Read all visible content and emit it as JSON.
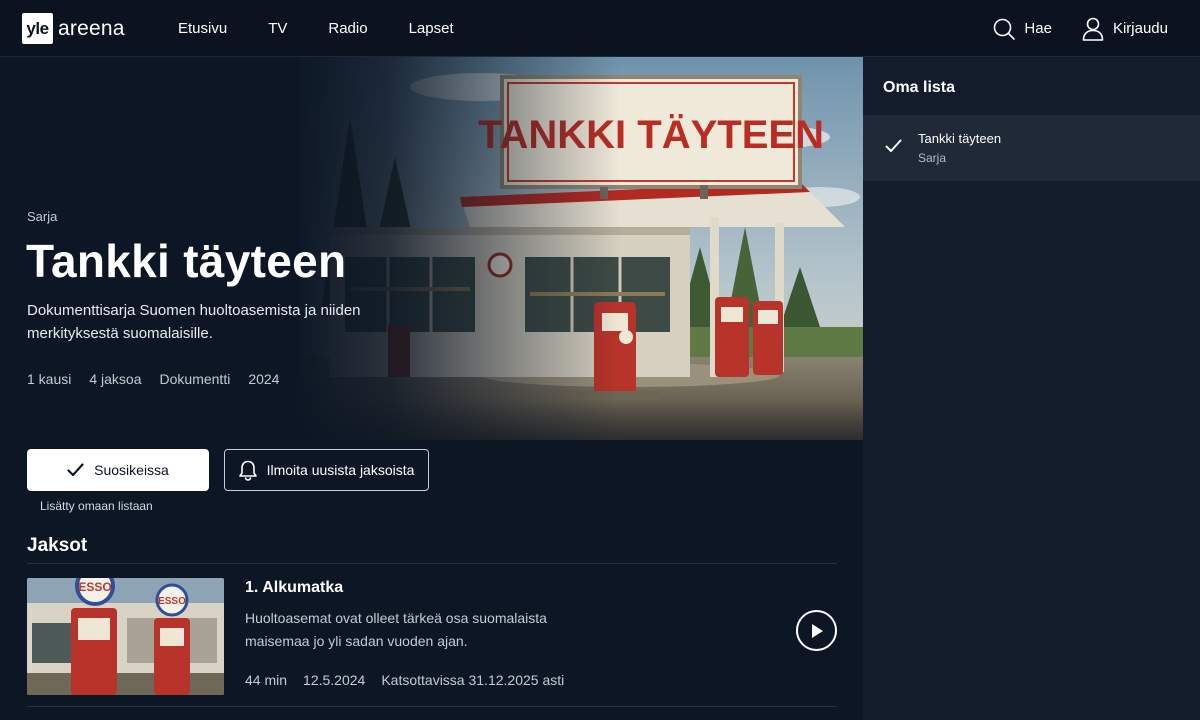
{
  "header": {
    "logo_box": "yle",
    "logo_text": "areena",
    "nav": [
      "Etusivu",
      "TV",
      "Radio",
      "Lapset"
    ],
    "search_label": "Hae",
    "login_label": "Kirjaudu"
  },
  "hero": {
    "type": "Sarja",
    "title": "Tankki täyteen",
    "description": "Dokumenttisarja Suomen huoltoasemista ja niiden merkityksestä suomalaisille.",
    "meta": [
      "1 kausi",
      "4 jaksoa",
      "Dokumentti",
      "2024"
    ],
    "sign_text": "TANKKI TÄYTEEN"
  },
  "actions": {
    "favorite_label": "Suosikeissa",
    "notify_label": "Ilmoita uusista jaksoista",
    "added_note": "Lisätty omaan listaan"
  },
  "episodes": {
    "section_title": "Jaksot",
    "items": [
      {
        "title": "1. Alkumatka",
        "description": "Huoltoasemat ovat olleet tärkeä osa suomalaista maisemaa jo yli sadan vuoden ajan.",
        "duration": "44 min",
        "date": "12.5.2024",
        "availability": "Katsottavissa 31.12.2025 asti",
        "thumb_sign": "ESSO"
      }
    ]
  },
  "side_panel": {
    "title": "Oma lista",
    "items": [
      {
        "title": "Tankki täyteen",
        "subtitle": "Sarja"
      }
    ]
  },
  "colors": {
    "background": "#0c1624",
    "header": "#0b1320",
    "panel": "#131c2a",
    "panel_item": "#1f2937",
    "accent_red": "#c0392b"
  }
}
